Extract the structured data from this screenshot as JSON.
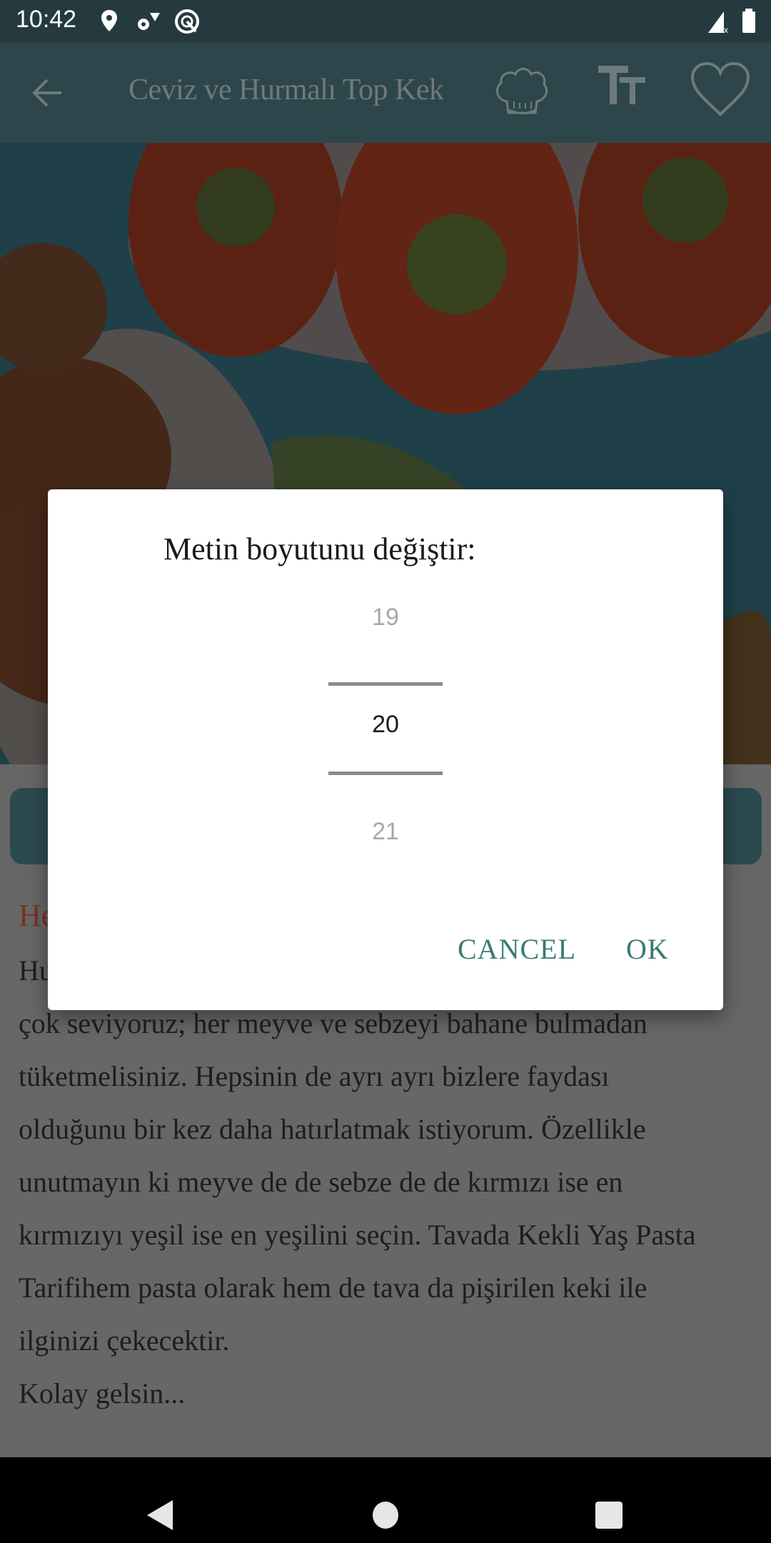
{
  "status_bar": {
    "time": "10:42",
    "left_icons": [
      "location-icon",
      "settings-sync-icon",
      "vpn-icon"
    ],
    "right_icons": [
      "signal-no-data-icon",
      "battery-icon"
    ]
  },
  "app_bar": {
    "back_icon": "arrow-left-icon",
    "title": "Ceviz ve Hurmalı Top Kek",
    "actions": [
      {
        "name": "chef-hat-icon",
        "label": "Chef"
      },
      {
        "name": "text-size-icon",
        "label": "Text size"
      },
      {
        "name": "heart-icon",
        "label": "Favorite"
      }
    ]
  },
  "content": {
    "heading_visible": "He",
    "body_lines": [
      "Hu",
      "çok seviyoruz; her meyve ve sebzeyi bahane bulmadan",
      "tüketmelisiniz. Hepsinin de ayrı ayrı bizlere faydası",
      "olduğunu bir kez daha hatırlatmak istiyorum. Özellikle",
      "unutmayın ki meyve de de sebze de de kırmızı ise en",
      "kırmızıyı yeşil ise en yeşilini seçin. Tavada Kekli Yaş Pasta",
      "Tarifihem pasta olarak hem de tava da pişirilen keki ile",
      "ilginizi çekecektir.",
      "Kolay gelsin..."
    ]
  },
  "dialog": {
    "title": "Metin boyutunu değiştir:",
    "picker": {
      "previous": "19",
      "selected": "20",
      "next": "21"
    },
    "cancel_label": "CANCEL",
    "ok_label": "OK",
    "accent_color": "#3a7a72"
  },
  "nav_bar": {
    "buttons": [
      "back",
      "home",
      "recents"
    ]
  }
}
